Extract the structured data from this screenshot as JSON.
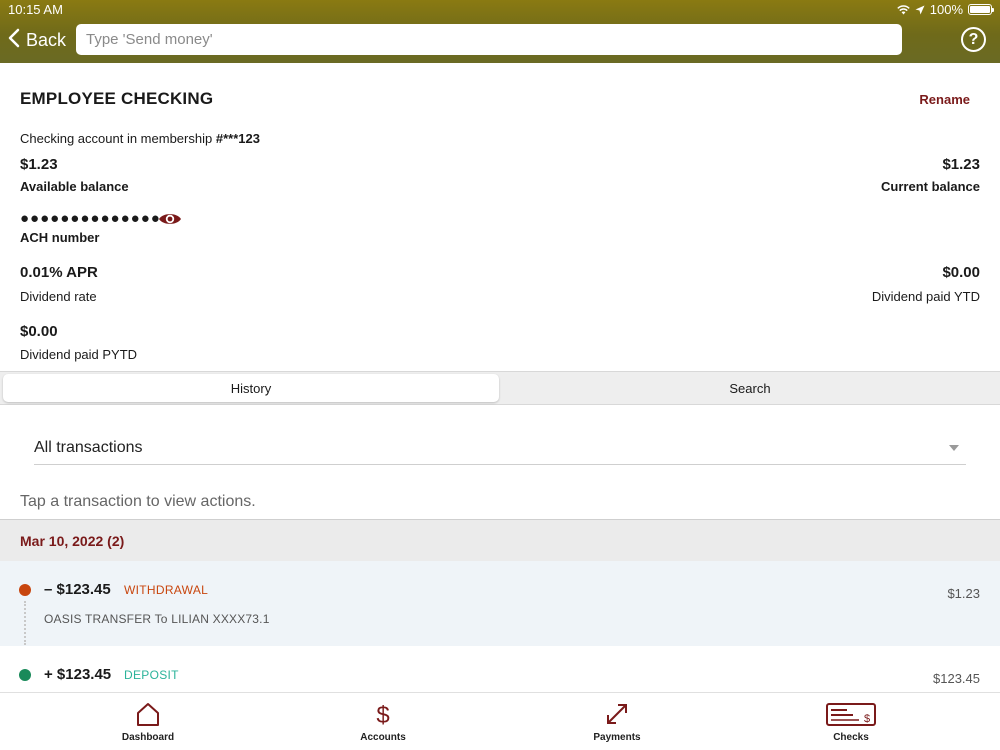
{
  "status_bar": {
    "time": "10:15 AM",
    "battery": "100%"
  },
  "header": {
    "back_label": "Back",
    "search_placeholder": "Type 'Send money'",
    "help_symbol": "?"
  },
  "account": {
    "title": "EMPLOYEE CHECKING",
    "rename_label": "Rename",
    "membership_text": "Checking account in membership",
    "membership_number": "#***123",
    "available_balance": "$1.23",
    "available_balance_label": "Available balance",
    "current_balance": "$1.23",
    "current_balance_label": "Current balance",
    "ach_masked": "●●●●●●●●●●●●●●",
    "ach_label": "ACH number",
    "apr": "0.01% APR",
    "apr_label": "Dividend rate",
    "dividend_ytd": "$0.00",
    "dividend_ytd_label": "Dividend paid YTD",
    "dividend_pytd": "$0.00",
    "dividend_pytd_label": "Dividend paid PYTD"
  },
  "segments": {
    "history": "History",
    "search": "Search"
  },
  "filter": {
    "selected": "All transactions"
  },
  "hint": "Tap a transaction to view actions.",
  "transactions": {
    "date_header": "Mar 10, 2022 (2)",
    "items": [
      {
        "amount": "– $123.45",
        "type": "WITHDRAWAL",
        "description": "OASIS TRANSFER To LILIAN XXXX73.1",
        "balance": "$1.23",
        "color": "#c8460e"
      },
      {
        "amount": "+ $123.45",
        "type": "DEPOSIT",
        "balance": "$123.45",
        "color": "#1a8a5a",
        "type_color": "#2bb39a"
      }
    ]
  },
  "tabs": [
    {
      "label": "Dashboard",
      "icon": "home-icon"
    },
    {
      "label": "Accounts",
      "icon": "dollar-icon"
    },
    {
      "label": "Payments",
      "icon": "transfer-arrows-icon"
    },
    {
      "label": "Checks",
      "icon": "check-icon"
    }
  ],
  "colors": {
    "brand_dark_red": "#7a1a1a",
    "header_olive": "#6f6a1a",
    "tab_highlight": "#e89a98"
  }
}
